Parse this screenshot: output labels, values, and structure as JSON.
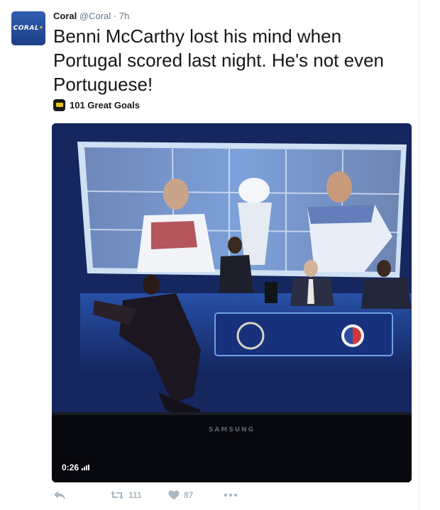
{
  "tweet": {
    "avatar_text": "CORAL",
    "avatar_dot": "•",
    "name": "Coral",
    "handle": "@Coral",
    "separator": "·",
    "time": "7h",
    "text": "Benni McCarthy lost his mind when Portugal scored last night. He's not even Portuguese!",
    "source": "101 Great Goals"
  },
  "video": {
    "duration": "0:26",
    "tv_brand": "SAMSUNG"
  },
  "actions": {
    "retweets": "111",
    "likes": "87"
  },
  "colors": {
    "text": "#14171a",
    "muted": "#657786",
    "action": "#aab8c2",
    "coral_blue": "#2f5fb0"
  },
  "icons": [
    "reply-icon",
    "retweet-icon",
    "heart-icon",
    "more-icon",
    "signal-icon"
  ]
}
